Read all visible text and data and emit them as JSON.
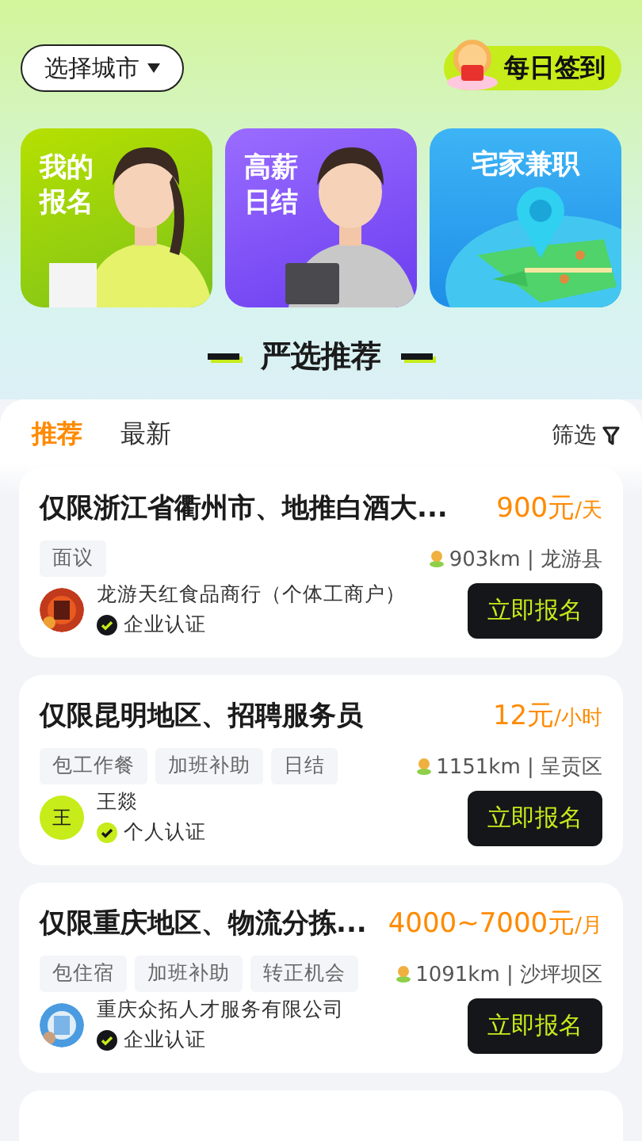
{
  "city_button": {
    "label": "选择城市"
  },
  "checkin": {
    "label": "每日签到"
  },
  "banners": [
    {
      "kind": "woman",
      "lines": [
        "我的",
        "报名"
      ]
    },
    {
      "kind": "man",
      "lines": [
        "高薪",
        "日结"
      ]
    },
    {
      "kind": "globe",
      "lines": [
        "宅家兼职"
      ]
    }
  ],
  "section_title": "严选推荐",
  "tabs": [
    {
      "label": "推荐",
      "selected": true
    },
    {
      "label": "最新",
      "selected": false
    }
  ],
  "filter": {
    "label": "筛选"
  },
  "jobs": [
    {
      "title": "仅限浙江省衢州市、地推白酒大...",
      "salary": "900元",
      "unit": "/天",
      "tags": [
        "面议"
      ],
      "distance": "903km | 龙游县",
      "company": "龙游天红食品商行（个体工商户）",
      "avatar": {
        "kind": "picture"
      },
      "verification": "企业认证",
      "kind": "enterprise",
      "button": "立即报名"
    },
    {
      "title": "仅限昆明地区、招聘服务员",
      "salary": "12元",
      "unit": "/小时",
      "tags": [
        "包工作餐",
        "加班补助",
        "日结"
      ],
      "distance": "1151km | 呈贡区",
      "company": "王燚",
      "avatar": {
        "kind": "text",
        "text": "王"
      },
      "verification": "个人认证",
      "kind": "personal",
      "button": "立即报名"
    },
    {
      "title": "仅限重庆地区、物流分拣...",
      "salary": "4000~7000元",
      "unit": "/月",
      "tags": [
        "包住宿",
        "加班补助",
        "转正机会"
      ],
      "distance": "1091km | 沙坪坝区",
      "company": "重庆众拓人才服务有限公司",
      "avatar": {
        "kind": "picture"
      },
      "verification": "企业认证",
      "kind": "enterprise",
      "button": "立即报名"
    }
  ]
}
